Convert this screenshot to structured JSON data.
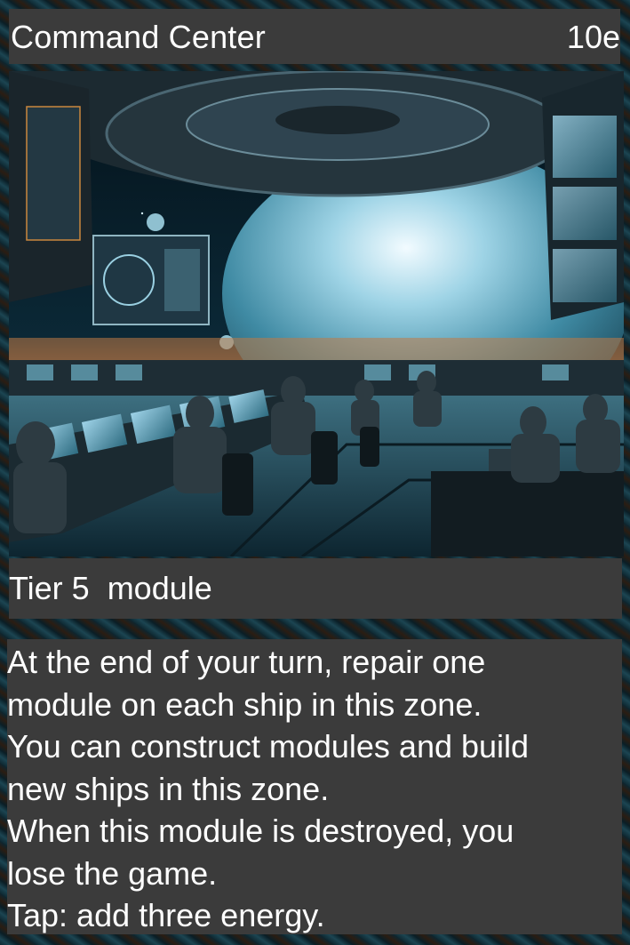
{
  "card": {
    "name": "Command Center",
    "cost": "10e",
    "type_line": "Tier 5  module",
    "rules_lines": [
      "At the end of your turn, repair one",
      "module on each ship in this zone.",
      "You can construct modules and build",
      "new ships in this zone.",
      "When this module is destroyed, you",
      "lose the game.",
      "Tap: add three energy."
    ],
    "art_description_icon": "command-center-artwork"
  },
  "colors": {
    "panel": "#3b3b3b",
    "text": "#ffffff",
    "border_texture_teal": "#1c4552",
    "border_texture_orange": "#2b1d12"
  }
}
